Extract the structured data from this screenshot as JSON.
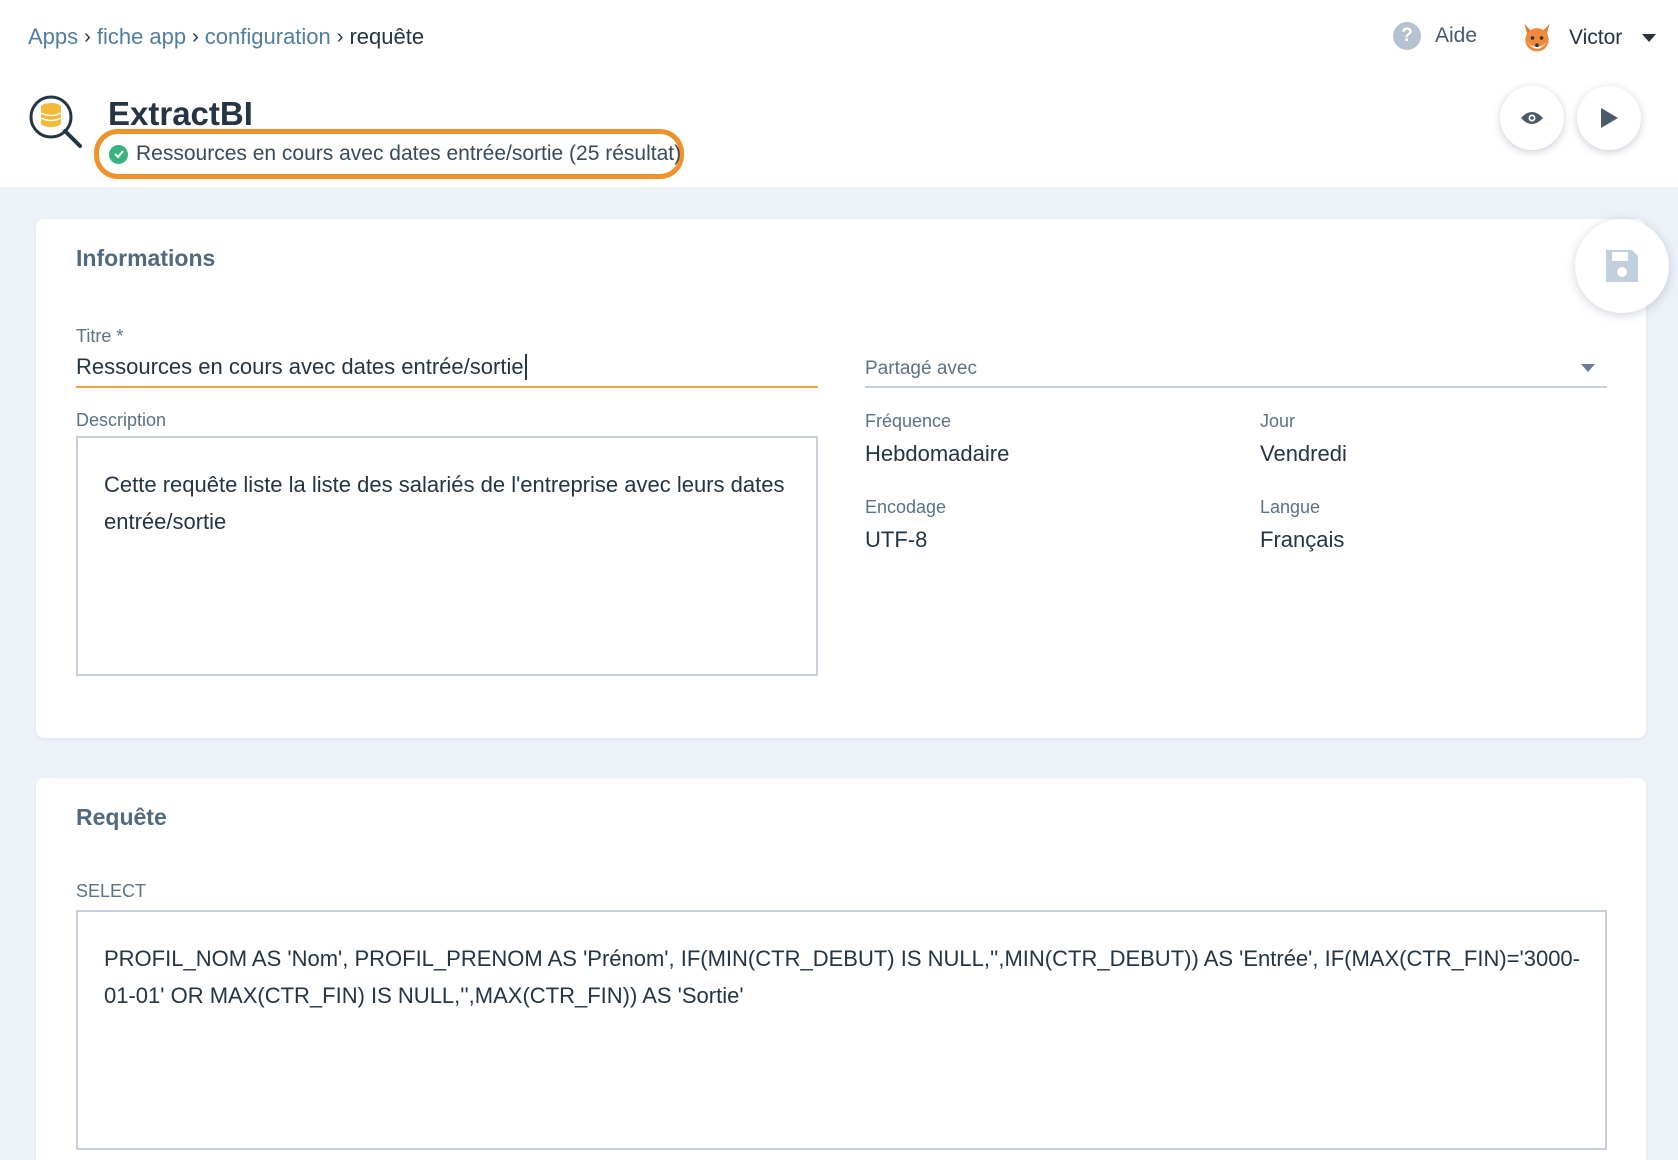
{
  "breadcrumb": [
    {
      "label": "Apps"
    },
    {
      "label": "fiche app"
    },
    {
      "label": "configuration"
    },
    {
      "label": "requête"
    }
  ],
  "header": {
    "help_label": "Aide",
    "user_name": "Victor",
    "app_title": "ExtractBI",
    "status_text": "Ressources en cours avec dates entrée/sortie (25 résultat)"
  },
  "informations": {
    "section_title": "Informations",
    "titre_label": "Titre *",
    "titre_value": "Ressources en cours avec dates entrée/sortie",
    "description_label": "Description",
    "description_value": "Cette requête liste la liste des salariés de l'entreprise avec leurs dates entrée/sortie",
    "partage_placeholder": "Partagé avec",
    "frequence_label": "Fréquence",
    "frequence_value": "Hebdomadaire",
    "jour_label": "Jour",
    "jour_value": "Vendredi",
    "encodage_label": "Encodage",
    "encodage_value": "UTF-8",
    "langue_label": "Langue",
    "langue_value": "Français"
  },
  "requete": {
    "section_title": "Requête",
    "select_label": "SELECT",
    "select_value": "PROFIL_NOM AS 'Nom', PROFIL_PRENOM AS 'Prénom', IF(MIN(CTR_DEBUT) IS NULL,'',MIN(CTR_DEBUT)) AS 'Entrée', IF(MAX(CTR_FIN)='3000-01-01' OR MAX(CTR_FIN) IS NULL,'',MAX(CTR_FIN)) AS 'Sortie'"
  },
  "colors": {
    "highlight": "#f0922c",
    "success": "#39b27d",
    "link": "#4f7fa0",
    "background": "#edf1f8"
  },
  "icons": [
    "help-icon",
    "avatar-fox",
    "database-search-icon",
    "check-circle-icon",
    "eye-icon",
    "play-icon",
    "save-icon",
    "chevron-down-icon"
  ]
}
